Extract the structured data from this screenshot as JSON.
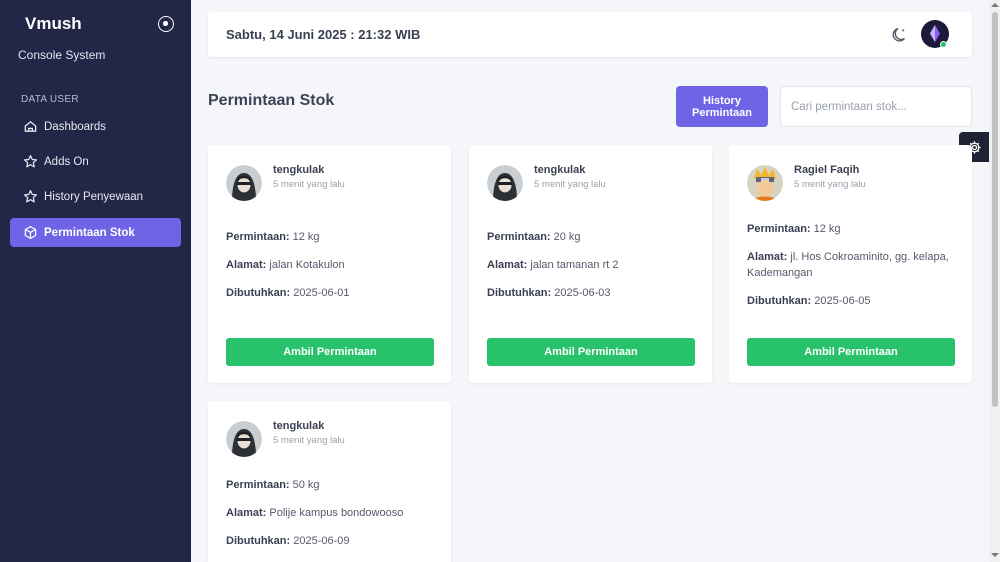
{
  "sidebar": {
    "brand": "Vmush",
    "subtitle": "Console System",
    "section_label": "DATA USER",
    "items": [
      {
        "label": "Dashboards",
        "icon": "home-icon",
        "active": false
      },
      {
        "label": "Adds On",
        "icon": "star-icon",
        "active": false
      },
      {
        "label": "History Penyewaan",
        "icon": "star-icon",
        "active": false
      },
      {
        "label": "Permintaan Stok",
        "icon": "box-icon",
        "active": true
      }
    ]
  },
  "topbar": {
    "datetime": "Sabtu, 14 Juni 2025 : 21:32 WIB",
    "theme_icon": "moon-icon",
    "avatar_icon": "crystal-avatar",
    "status": "online"
  },
  "main": {
    "title": "Permintaan Stok",
    "history_button": "History Permintaan",
    "search_placeholder": "Cari permintaan stok...",
    "field_labels": {
      "request": "Permintaan:",
      "address": "Alamat:",
      "needed": "Dibutuhkan:"
    },
    "take_button": "Ambil Permintaan",
    "cards": [
      {
        "user": "tengkulak",
        "time": "5 menit yang lalu",
        "avatar": "hooded-girl-avatar",
        "request": "12 kg",
        "address": "jalan Kotakulon",
        "needed": "2025-06-01"
      },
      {
        "user": "tengkulak",
        "time": "5 menit yang lalu",
        "avatar": "hooded-girl-avatar",
        "request": "20 kg",
        "address": "jalan tamanan rt 2",
        "needed": "2025-06-03"
      },
      {
        "user": "Ragiel Faqih",
        "time": "5 menit yang lalu",
        "avatar": "ninja-avatar",
        "request": "12 kg",
        "address": "jl. Hos Cokroaminito, gg. kelapa, Kademangan",
        "needed": "2025-06-05"
      },
      {
        "user": "tengkulak",
        "time": "5 menit yang lalu",
        "avatar": "hooded-girl-avatar",
        "request": "50 kg",
        "address": "Polije kampus bondowooso",
        "needed": "2025-06-09"
      }
    ]
  },
  "colors": {
    "sidebar_bg": "#222647",
    "accent": "#6f63e6",
    "success": "#27c26a",
    "page_bg": "#f5f6fa"
  }
}
